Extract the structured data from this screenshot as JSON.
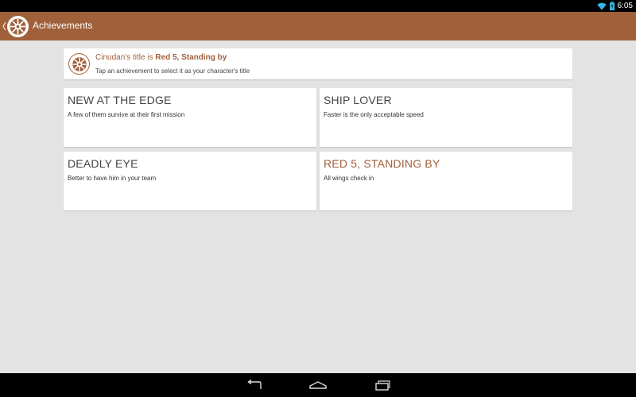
{
  "status_bar": {
    "time": "6:05",
    "icons": [
      "wifi-icon",
      "battery-charging-icon"
    ],
    "icon_color": "#33b5e5"
  },
  "action_bar": {
    "title": "Achievements",
    "color": "#a0603a"
  },
  "current_title": {
    "prefix": "Cinudan's title is ",
    "title": "Red 5, Standing by",
    "hint": "Tap an achievement to select it as your character's title"
  },
  "achievements": [
    {
      "name": "NEW AT THE EDGE",
      "description": "A few of them survive at their first mission",
      "selected": false
    },
    {
      "name": "SHIP LOVER",
      "description": "Faster is the only acceptable speed",
      "selected": false
    },
    {
      "name": "DEADLY EYE",
      "description": "Better to have him in your team",
      "selected": false
    },
    {
      "name": "RED 5, STANDING BY",
      "description": "All wings check in",
      "selected": true
    }
  ],
  "nav_bar": {
    "buttons": [
      "back-icon",
      "home-icon",
      "recent-apps-icon"
    ]
  }
}
